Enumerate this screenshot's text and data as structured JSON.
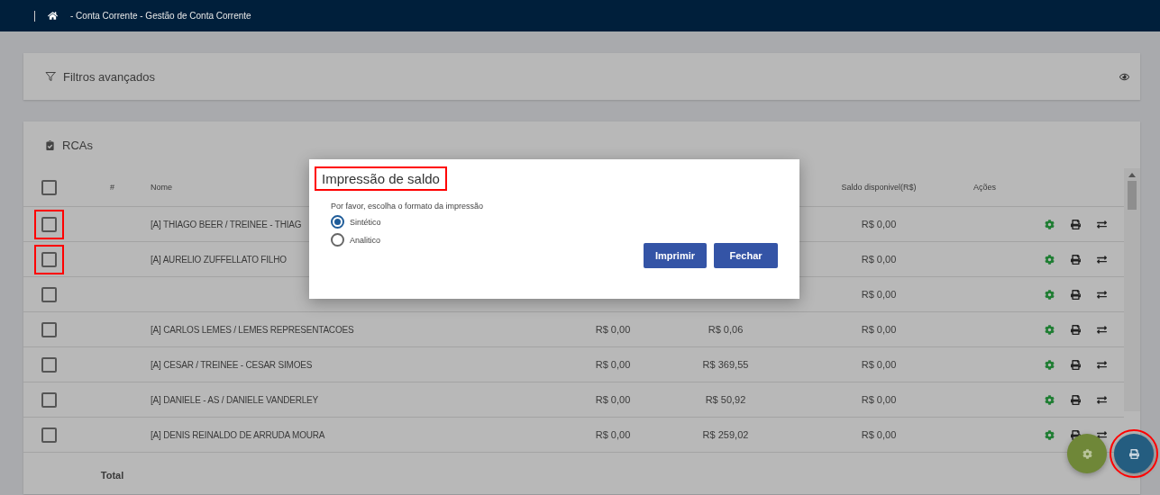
{
  "topbar": {
    "breadcrumb": "- Conta Corrente - Gestão de Conta Corrente"
  },
  "filters": {
    "title": "Filtros avançados"
  },
  "rcas": {
    "title": "RCAs",
    "columns": [
      {
        "kind": "check",
        "checked": false
      },
      {
        "kind": "text",
        "label": "#"
      },
      {
        "kind": "text",
        "label": "Nome"
      },
      {
        "kind": "hidden"
      },
      {
        "kind": "hidden"
      },
      {
        "kind": "text",
        "label": "Saldo disponivel(R$)"
      },
      {
        "kind": "text",
        "label": "Ações"
      }
    ],
    "rows": [
      {
        "checked": false,
        "highlighted": true,
        "name": "[A] THIAGO BEER / TREINEE - THIAG",
        "saldo": "R$ 0,00"
      },
      {
        "checked": false,
        "highlighted": true,
        "name": "[A] AURELIO ZUFFELLATO FILHO",
        "saldo": "R$ 0,00"
      },
      {
        "checked": false,
        "highlighted": false,
        "saldo": "R$ 0,00"
      },
      {
        "checked": false,
        "highlighted": false,
        "name": "[A] CARLOS LEMES / LEMES REPRESENTACOES",
        "col4": "R$ 0,00",
        "col5": "R$ 0,06",
        "saldo": "R$ 0,00"
      },
      {
        "checked": false,
        "highlighted": false,
        "name": "[A] CESAR / TREINEE - CESAR SIMOES",
        "col4": "R$ 0,00",
        "col5": "R$ 369,55",
        "saldo": "R$ 0,00"
      },
      {
        "checked": false,
        "highlighted": false,
        "name": "[A] DANIELE - AS / DANIELE VANDERLEY",
        "col4": "R$ 0,00",
        "col5": "R$ 50,92",
        "saldo": "R$ 0,00"
      },
      {
        "checked": false,
        "highlighted": false,
        "name": "[A] DENIS REINALDO DE ARRUDA MOURA",
        "col4": "R$ 0,00",
        "col5": "R$ 259,02",
        "saldo": "R$ 0,00"
      }
    ],
    "total_label": "Total"
  },
  "dialog": {
    "title": "Impressão de saldo",
    "title_highlighted": true,
    "prompt": "Por favor, escolha o formato da impressão",
    "options": [
      {
        "label": "Sintético",
        "selected": true
      },
      {
        "label": "Analitico",
        "selected": false
      }
    ],
    "buttons": [
      "Imprimir",
      "Fechar"
    ]
  },
  "fabs": [
    {
      "kind": "settings",
      "highlighted": false
    },
    {
      "kind": "print",
      "highlighted": true
    }
  ]
}
